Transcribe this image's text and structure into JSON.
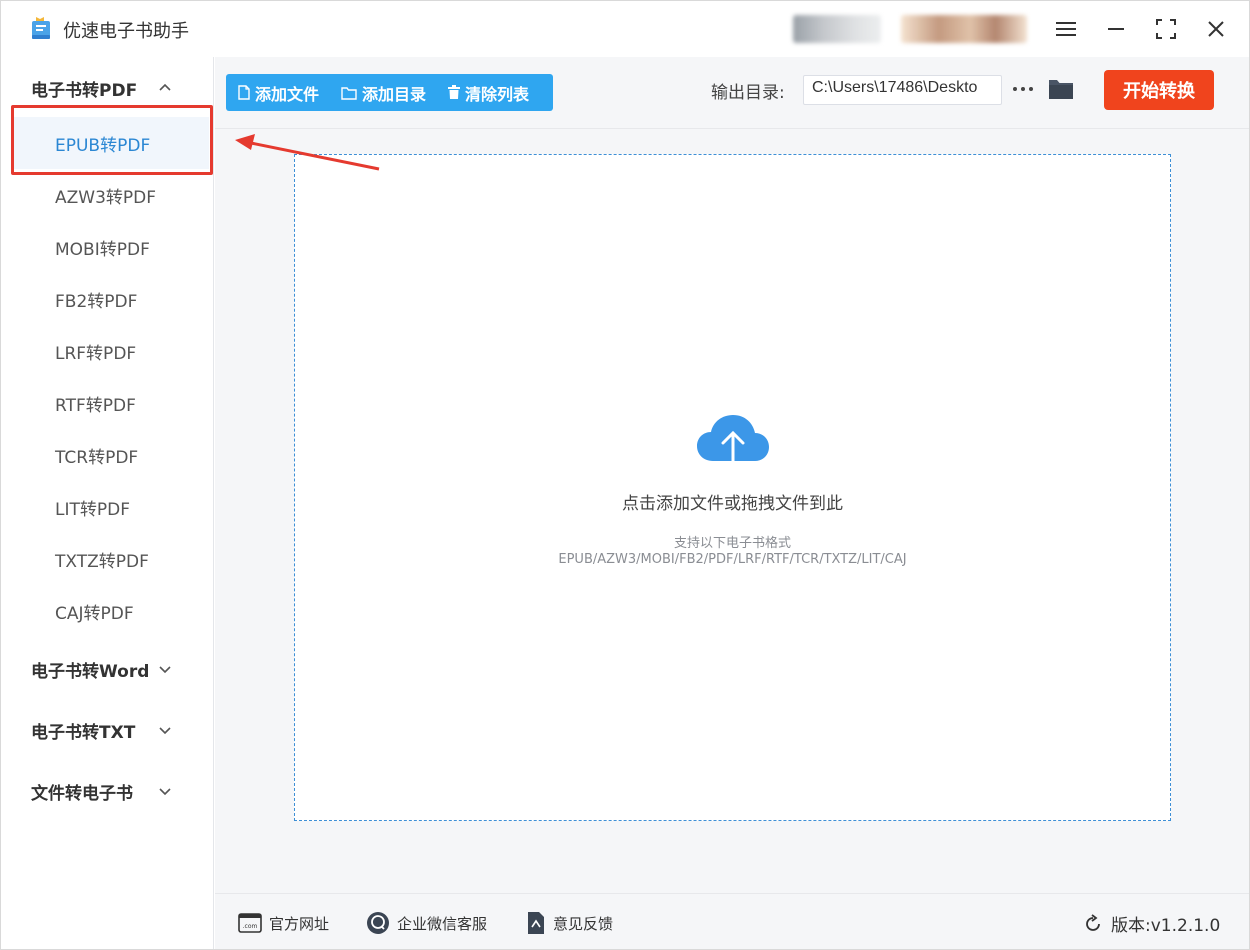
{
  "app": {
    "title": "优速电子书助手"
  },
  "sidebar": {
    "groups": [
      {
        "label": "电子书转PDF",
        "expanded": true
      },
      {
        "label": "电子书转Word",
        "expanded": false
      },
      {
        "label": "电子书转TXT",
        "expanded": false
      },
      {
        "label": "文件转电子书",
        "expanded": false
      }
    ],
    "items": [
      {
        "label": "EPUB转PDF",
        "active": true
      },
      {
        "label": "AZW3转PDF"
      },
      {
        "label": "MOBI转PDF"
      },
      {
        "label": "FB2转PDF"
      },
      {
        "label": "LRF转PDF"
      },
      {
        "label": "RTF转PDF"
      },
      {
        "label": "TCR转PDF"
      },
      {
        "label": "LIT转PDF"
      },
      {
        "label": "TXTZ转PDF"
      },
      {
        "label": "CAJ转PDF"
      }
    ]
  },
  "toolbar": {
    "add_file": "添加文件",
    "add_dir": "添加目录",
    "clear_list": "清除列表",
    "output_label": "输出目录:",
    "output_path": "C:\\Users\\17486\\Deskto",
    "start_button": "开始转换"
  },
  "dropzone": {
    "main_text": "点击添加文件或拖拽文件到此",
    "support_title": "支持以下电子书格式",
    "support_formats": "EPUB/AZW3/MOBI/FB2/PDF/LRF/RTF/TCR/TXTZ/LIT/CAJ"
  },
  "footer": {
    "website": "官方网址",
    "wechat": "企业微信客服",
    "feedback": "意见反馈",
    "version": "版本:v1.2.1.0"
  },
  "colors": {
    "accent": "#2fa6f0",
    "start": "#f0441d",
    "active_text": "#2b87d3",
    "highlight": "#e53a2f"
  }
}
